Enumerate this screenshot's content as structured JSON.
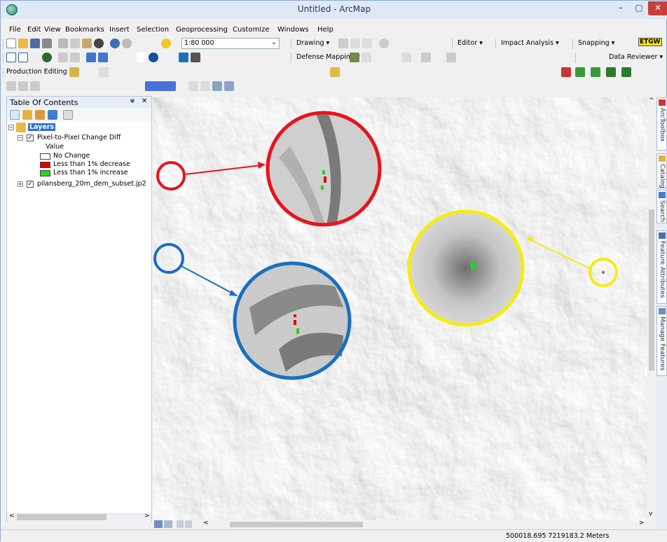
{
  "window": {
    "title": "Untitled - ArcMap",
    "min_glyph": "–",
    "max_glyph": "▢",
    "close_glyph": "✕"
  },
  "menubar": [
    "File",
    "Edit",
    "View",
    "Bookmarks",
    "Insert",
    "Selection",
    "Geoprocessing",
    "Customize",
    "Windows",
    "Help"
  ],
  "toolbar1": {
    "scale": "1:80 000",
    "drawing": "Drawing ▾",
    "editor": "Editor ▾",
    "impact": "Impact Analysis ▾",
    "snapping": "Snapping ▾",
    "etgw": "ETGW"
  },
  "toolbar2": {
    "defense": "Defense Mapping ▾",
    "reviewer": "Data Reviewer ▾"
  },
  "toolbar3": {
    "production": "Production Editing ▾"
  },
  "toc": {
    "title": "Table Of Contents",
    "pin": "ᴪ",
    "close": "✕",
    "layers_label": "Layers",
    "layer1": "Pixel-to-Pixel Change Diff",
    "value_label": "Value",
    "legend": [
      {
        "label": "No Change",
        "color": "#ffffff"
      },
      {
        "label": "Less than 1% decrease",
        "color": "#e00000"
      },
      {
        "label": "Less than 1% increase",
        "color": "#22d61e"
      }
    ],
    "layer2": "pilansberg_20m_dem_subset.jp2"
  },
  "annotation_colors": {
    "red": "#e8141b",
    "blue": "#1a6fc0",
    "yellow": "#f5ec12"
  },
  "dock_tabs": [
    "ArcToolbox",
    "Catalog",
    "Search",
    "Feature Attributes",
    "Manage Features"
  ],
  "status": {
    "coordinates": "500018.695  7219183.2 Meters"
  }
}
